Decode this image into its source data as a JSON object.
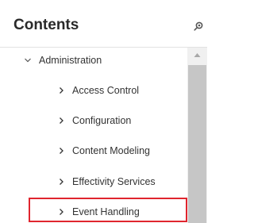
{
  "header": {
    "title": "Contents",
    "pin_icon": "pin-icon"
  },
  "tree": {
    "root": {
      "label": "Administration",
      "expanded": true,
      "icon": "chevron-down-icon"
    },
    "children": [
      {
        "label": "Access Control",
        "icon": "chevron-right-icon"
      },
      {
        "label": "Configuration",
        "icon": "chevron-right-icon"
      },
      {
        "label": "Content Modeling",
        "icon": "chevron-right-icon"
      },
      {
        "label": "Effectivity Services",
        "icon": "chevron-right-icon"
      },
      {
        "label": "Event Handling",
        "icon": "chevron-right-icon",
        "highlighted": true
      }
    ]
  },
  "colors": {
    "highlight_border": "#e0252e",
    "scroll_track": "#f0f0f0",
    "scroll_thumb": "#c6c6c6"
  }
}
